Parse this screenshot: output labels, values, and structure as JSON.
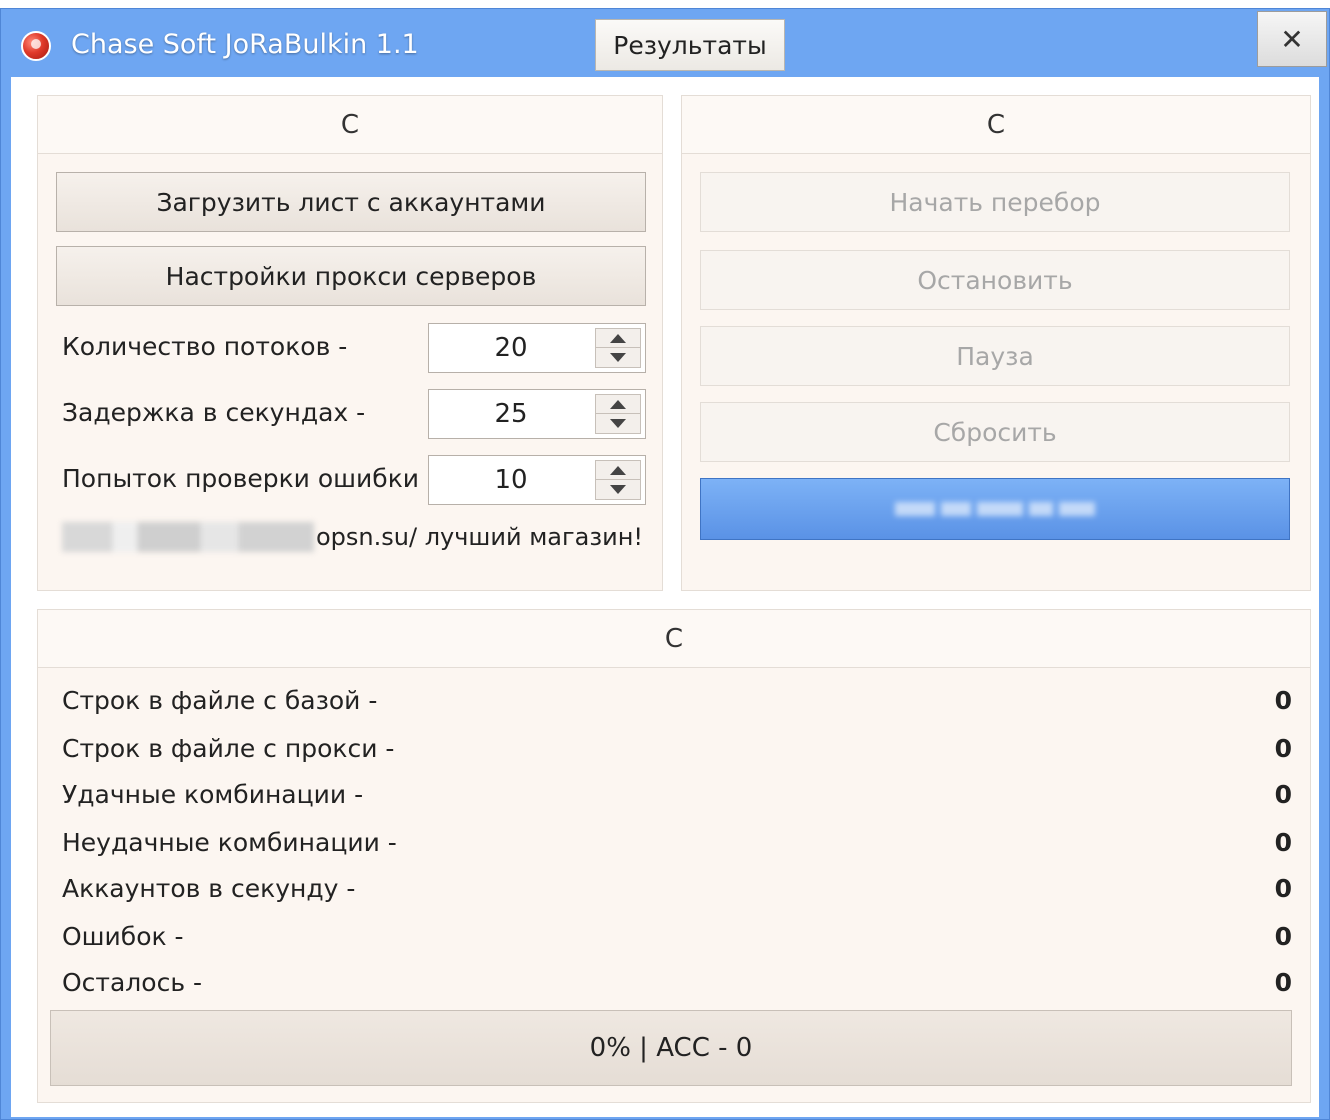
{
  "window": {
    "title": "Chase Soft JoRaBulkin 1.1",
    "results_button": "Результаты",
    "close_glyph": "✕",
    "colors": {
      "titlebar": "#6ea6f2",
      "panel": "#fcf6f1",
      "primary_button": "#5a92e6"
    }
  },
  "left_group": {
    "header": "C",
    "load_accounts_button": "Загрузить лист с аккаунтами",
    "proxy_settings_button": "Настройки прокси серверов",
    "fields": [
      {
        "label": "Количество потоков -",
        "value": "20"
      },
      {
        "label": "Задержка в секундах -",
        "value": "25"
      },
      {
        "label": "Попыток проверки ошибки -",
        "value": "10"
      }
    ],
    "promo_text": "opsn.su/ лучший магазин!"
  },
  "right_group": {
    "header": "C",
    "buttons": [
      {
        "label": "Начать перебор",
        "enabled": false
      },
      {
        "label": "Остановить",
        "enabled": false
      },
      {
        "label": "Пауза",
        "enabled": false
      },
      {
        "label": "Сбросить",
        "enabled": false
      }
    ]
  },
  "stats_group": {
    "header": "C",
    "rows": [
      {
        "label": "Строк в файле с базой -",
        "value": "0"
      },
      {
        "label": "Строк в файле с прокси -",
        "value": "0"
      },
      {
        "label": "Удачные комбинации -",
        "value": "0"
      },
      {
        "label": "Неудачные комбинации -",
        "value": "0"
      },
      {
        "label": "Аккаунтов в секунду -",
        "value": "0"
      },
      {
        "label": "Ошибок -",
        "value": "0"
      },
      {
        "label": "Осталось -",
        "value": "0"
      }
    ],
    "progress_text": "0% | ACC - 0",
    "progress_percent": 0
  }
}
